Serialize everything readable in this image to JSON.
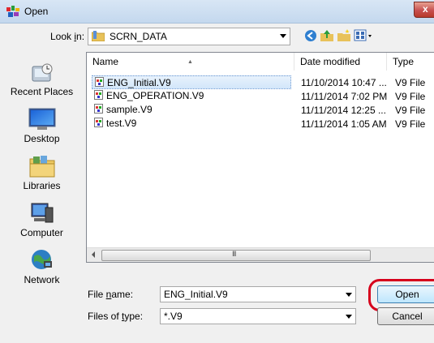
{
  "window": {
    "title": "Open",
    "close_label": "x"
  },
  "lookin": {
    "label": "Look in:",
    "value": "SCRN_DATA"
  },
  "places": [
    {
      "label": "Recent Places",
      "icon": "recent-places-icon"
    },
    {
      "label": "Desktop",
      "icon": "desktop-icon"
    },
    {
      "label": "Libraries",
      "icon": "libraries-icon"
    },
    {
      "label": "Computer",
      "icon": "computer-icon"
    },
    {
      "label": "Network",
      "icon": "network-icon"
    }
  ],
  "columns": {
    "name": "Name",
    "date": "Date modified",
    "type": "Type"
  },
  "files": [
    {
      "name": "ENG_Initial.V9",
      "date": "11/10/2014 10:47 ...",
      "type": "V9 File",
      "selected": true
    },
    {
      "name": "ENG_OPERATION.V9",
      "date": "11/11/2014 7:02 PM",
      "type": "V9 File",
      "selected": false
    },
    {
      "name": "sample.V9",
      "date": "11/11/2014 12:25 ...",
      "type": "V9 File",
      "selected": false
    },
    {
      "name": "test.V9",
      "date": "11/11/2014 1:05 AM",
      "type": "V9 File",
      "selected": false
    }
  ],
  "scrollbar": {
    "grip": "III"
  },
  "filename": {
    "label": "File name:",
    "value": "ENG_Initial.V9"
  },
  "filetype": {
    "label": "Files of type:",
    "value": "*.V9"
  },
  "buttons": {
    "open": "Open",
    "cancel": "Cancel"
  },
  "colors": {
    "highlight": "#d6001c",
    "selection": "#d2e6fa",
    "titlebar": "#c4d8ee"
  }
}
